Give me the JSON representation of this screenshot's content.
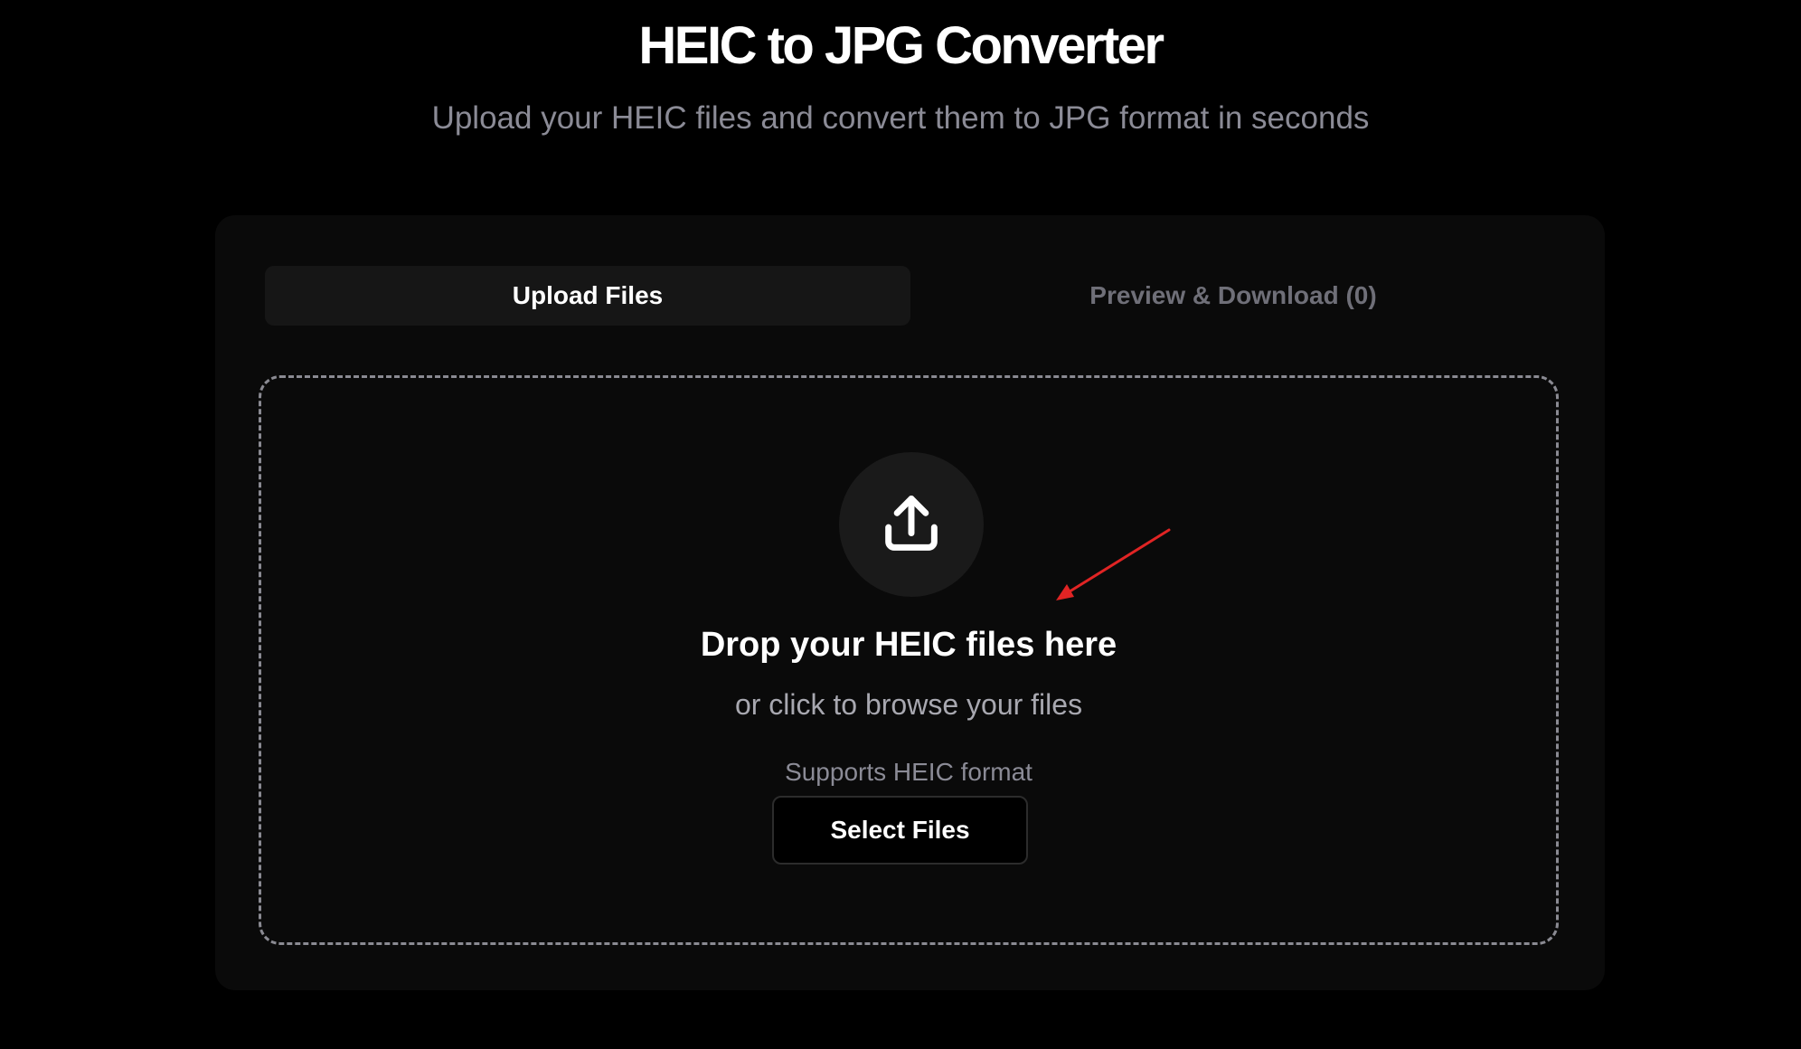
{
  "header": {
    "title": "HEIC to JPG Converter",
    "subtitle": "Upload your HEIC files and convert them to JPG format in seconds"
  },
  "tabs": [
    {
      "label": "Upload Files",
      "active": true
    },
    {
      "label": "Preview & Download (0)",
      "active": false
    }
  ],
  "dropzone": {
    "icon": "upload-icon",
    "title": "Drop your HEIC files here",
    "subtitle": "or click to browse your files",
    "supports": "Supports HEIC format",
    "button_label": "Select Files"
  },
  "annotation": {
    "icon": "red-arrow",
    "color": "#e02424"
  },
  "colors": {
    "background": "#000000",
    "card": "#0a0a0a",
    "muted_text": "#8b8b96"
  }
}
